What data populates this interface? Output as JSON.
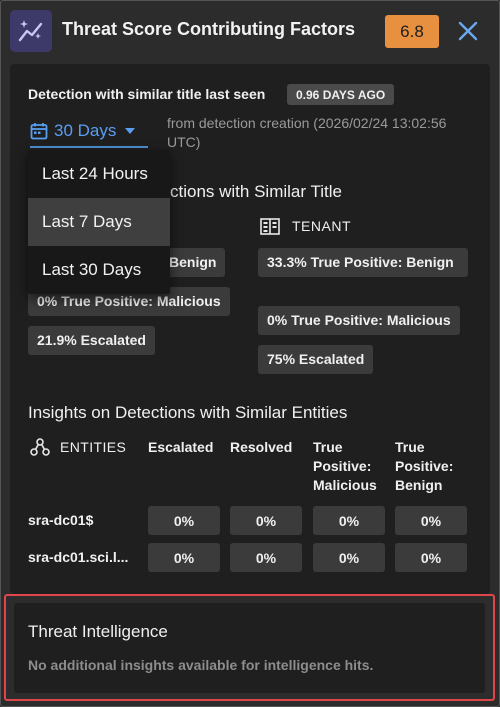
{
  "header": {
    "title": "Threat Score Contributing Factors",
    "score": "6.8",
    "logo_icon": "sparkle-trend-icon",
    "close_icon": "close-icon"
  },
  "last_seen": {
    "label": "Detection with similar title last seen",
    "badge": "0.96 DAYS AGO"
  },
  "range_select": {
    "value": "30 Days",
    "from_text": "from detection creation (2026/02/24 13:02:56 UTC)",
    "options": [
      "Last 24 Hours",
      "Last 7 Days",
      "Last 30 Days"
    ],
    "highlighted_option": "Last 7 Days"
  },
  "similar_title": {
    "heading_visible": "ctions with Similar Title",
    "left_chips": [
      "Benign",
      "0% True Positive: Malicious",
      "21.9% Escalated"
    ],
    "tenant": {
      "label": "TENANT",
      "chips": [
        "33.3% True Positive: Benign",
        "0% True Positive: Malicious",
        "75% Escalated"
      ]
    }
  },
  "entities": {
    "heading": "Insights on Detections with Similar Entities",
    "label": "ENTITIES",
    "columns": [
      "Escalated",
      "Resolved",
      "True Positive: Malicious",
      "True Positive: Benign"
    ],
    "rows": [
      {
        "name": "sra-dc01$",
        "values": [
          "0%",
          "0%",
          "0%",
          "0%"
        ]
      },
      {
        "name": "sra-dc01.sci.l...",
        "values": [
          "0%",
          "0%",
          "0%",
          "0%"
        ]
      }
    ]
  },
  "threat_intel": {
    "title": "Threat Intelligence",
    "text": "No additional insights available for intelligence hits."
  },
  "colors": {
    "accent_blue": "#5a9ef0",
    "score_orange": "#e7903f",
    "highlight_red": "#e0454a"
  }
}
